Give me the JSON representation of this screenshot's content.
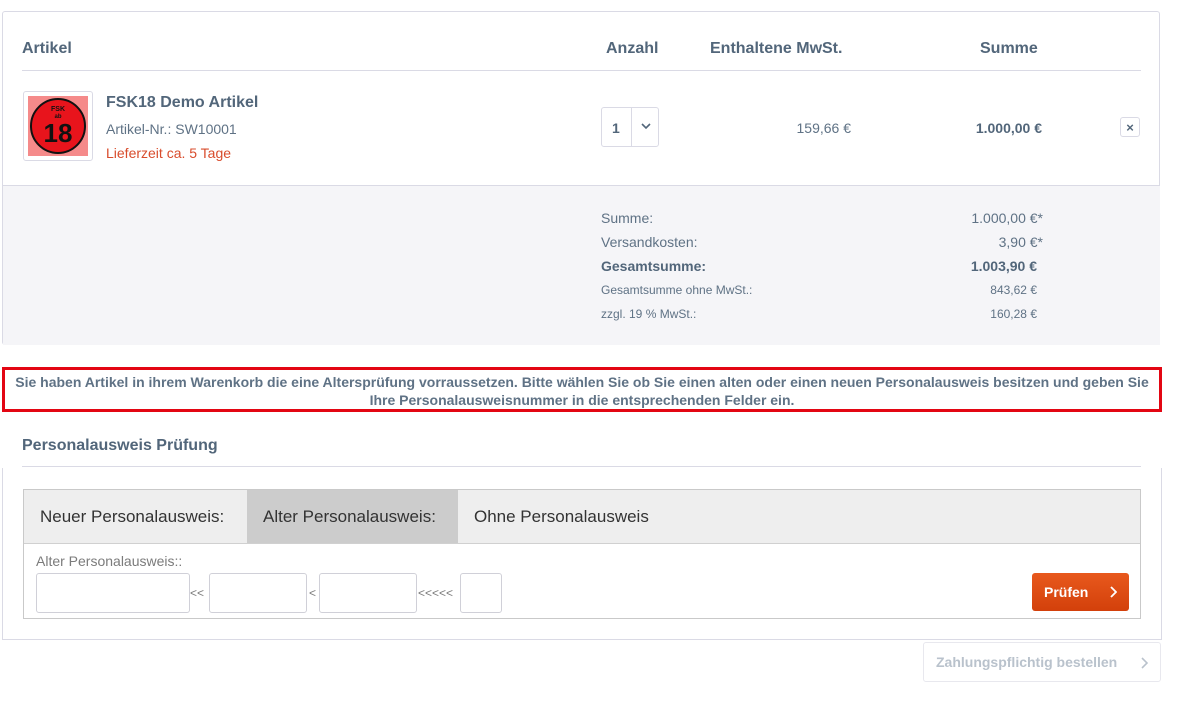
{
  "cart": {
    "headers": {
      "article": "Artikel",
      "quantity": "Anzahl",
      "tax": "Enthaltene MwSt.",
      "sum": "Summe"
    },
    "item": {
      "thumb_badge_top": "FSK",
      "thumb_badge_mid": "ab",
      "thumb_badge_num": "18",
      "name": "FSK18 Demo Artikel",
      "number_label": "Artikel-Nr.:",
      "number": "SW10001",
      "delivery": "Lieferzeit ca. 5 Tage",
      "quantity": "1",
      "tax": "159,66 €",
      "sum": "1.000,00 €",
      "remove_label": "×"
    },
    "summary": {
      "subtotal_label": "Summe:",
      "subtotal_value": "1.000,00 €*",
      "shipping_label": "Versandkosten:",
      "shipping_value": "3,90 €*",
      "total_label": "Gesamtsumme:",
      "total_value": "1.003,90 €",
      "net_label": "Gesamtsumme ohne MwSt.:",
      "net_value": "843,62 €",
      "vat_label": "zzgl. 19 % MwSt.:",
      "vat_value": "160,28 €"
    }
  },
  "notice": {
    "text": "Sie haben Artikel in ihrem Warenkorb die eine Altersprüfung vorraussetzen. Bitte wählen Sie ob Sie einen alten oder einen neuen Personalausweis besitzen und geben Sie Ihre Personalausweisnummer in die entsprechenden Felder ein."
  },
  "id_check": {
    "title": "Personalausweis Prüfung",
    "tabs": [
      {
        "label": "Neuer Personalausweis:"
      },
      {
        "label": "Alter Personalausweis:"
      },
      {
        "label": "Ohne Personalausweis"
      }
    ],
    "active_tab": 1,
    "field_label": "Alter Personalausweis::",
    "separators": [
      "<<",
      "<",
      "<<<<<"
    ],
    "check_button": "Prüfen"
  },
  "order_button": "Zahlungspflichtig bestellen",
  "colors": {
    "accent": "#e8591d",
    "notice_border": "#e30613",
    "delivery": "#d84c2c"
  }
}
